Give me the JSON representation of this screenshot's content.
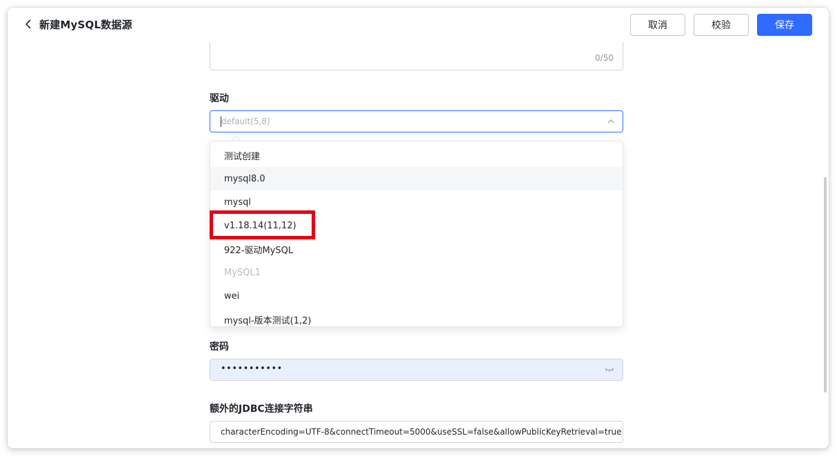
{
  "header": {
    "title": "新建MySQL数据源",
    "cancel_label": "取消",
    "verify_label": "校验",
    "save_label": "保存"
  },
  "description": {
    "char_count": "0/50"
  },
  "driver": {
    "label": "驱动",
    "placeholder": "default(5,8)",
    "options": [
      {
        "label": "测试创建"
      },
      {
        "label": "mysql8.0"
      },
      {
        "label": "mysql"
      },
      {
        "label": "v1.18.14(11,12)"
      },
      {
        "label": "922-驱动MySQL"
      },
      {
        "label": "MySQL1"
      },
      {
        "label": "wei"
      },
      {
        "label": "mysql-版本测试(1,2)"
      }
    ]
  },
  "password": {
    "label": "密码",
    "value": "•••••••••••"
  },
  "jdbc": {
    "label": "额外的JDBC连接字符串",
    "value": "characterEncoding=UTF-8&connectTimeout=5000&useSSL=false&allowPublicKeyRetrieval=true"
  },
  "colors": {
    "primary": "#2f6bff",
    "highlight": "#e60012",
    "autofill": "#e8f0fe"
  }
}
